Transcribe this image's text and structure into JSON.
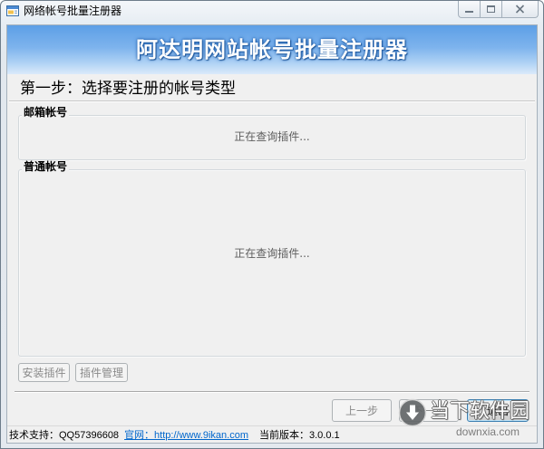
{
  "window": {
    "title": "网络帐号批量注册器"
  },
  "banner": {
    "title": "阿达明网站帐号批量注册器"
  },
  "step": {
    "heading": "第一步：选择要注册的帐号类型"
  },
  "groups": [
    {
      "label": "邮箱帐号",
      "status": "正在查询插件..."
    },
    {
      "label": "普通帐号",
      "status": "正在查询插件..."
    }
  ],
  "plugin_buttons": {
    "install": {
      "label": "安装插件",
      "enabled": false
    },
    "manage": {
      "label": "插件管理",
      "enabled": false
    }
  },
  "nav_buttons": {
    "prev": {
      "label": "上一步",
      "enabled": false
    },
    "next": {
      "label": "下一步",
      "enabled": false
    },
    "exit": {
      "label": "退出",
      "enabled": true
    }
  },
  "status_bar": {
    "support": "技术支持：QQ57396608",
    "website": "官网：http://www.9ikan.com",
    "version": "当前版本：3.0.0.1"
  },
  "watermark": {
    "name": "当下软件园",
    "domain": "downxia.com"
  },
  "icons": {
    "app": "app-icon",
    "minimize": "minimize-icon",
    "maximize": "maximize-icon",
    "close": "close-icon",
    "watermark_logo": "download-arrow-icon"
  },
  "colors": {
    "banner_top": "#5d9fe6",
    "banner_bottom": "#dbeafa",
    "banner_text": "#ffffff",
    "link": "#0066cc",
    "disabled_text": "#8a8a8a"
  }
}
